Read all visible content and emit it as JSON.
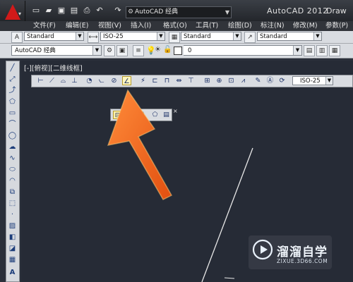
{
  "title_bar": {
    "workspace": "AutoCAD 经典",
    "app_title": "AutoCAD 2012",
    "drawing_title": "Draw"
  },
  "menu": [
    "文件(F)",
    "编辑(E)",
    "视图(V)",
    "插入(I)",
    "格式(O)",
    "工具(T)",
    "绘图(D)",
    "标注(N)",
    "修改(M)",
    "参数(P)"
  ],
  "styles_toolbar": {
    "text_style": "Standard",
    "dim_style": "ISO-25",
    "table_style": "Standard",
    "multileader_style": "Standard"
  },
  "layer_toolbar": {
    "workspace": "AutoCAD 经典",
    "current_layer": "0"
  },
  "viewport_label": "[-][俯视][二维线框]",
  "dimension_toolbar": {
    "dim_style": "ISO-25"
  },
  "watermark": {
    "brand": "溜溜自学",
    "url": "ZIXUE.3D66.COM"
  },
  "colors": {
    "canvas": "#262b36",
    "toolbar": "#d9dce1",
    "arrow": "#f06a1c",
    "highlight": "#ffe27a"
  }
}
